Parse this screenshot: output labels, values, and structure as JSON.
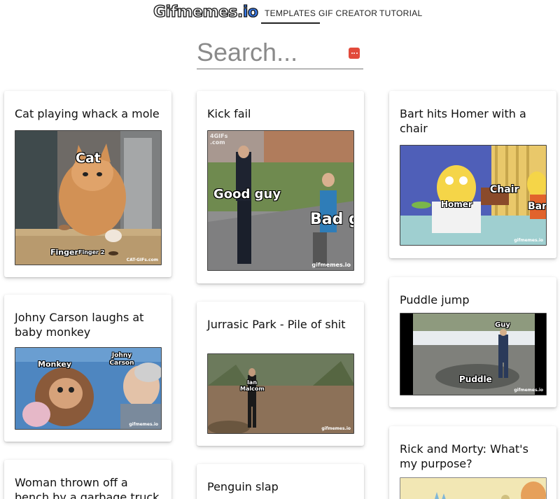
{
  "header": {
    "logo_main": "Gifmemes.",
    "logo_accent": "io",
    "nav": {
      "templates": "TEMPLATES",
      "gif_creator": "GIF CREATOR",
      "tutorial": "TUTORIAL"
    },
    "active_tab": "TEMPLATES"
  },
  "search": {
    "placeholder": "Search...",
    "value": ""
  },
  "cards": {
    "cat": {
      "title": "Cat playing whack a mole",
      "cap_cat": "Cat",
      "cap_finger": "Finger",
      "cap_finger2": "Finger 2",
      "watermark": "CAT-GIFs.com"
    },
    "kick": {
      "title": "Kick fail",
      "cap_good": "Good guy",
      "cap_bad": "Bad gu",
      "watermark": "gifmemes.io",
      "corner": "4GIFs .com"
    },
    "bart": {
      "title": "Bart hits Homer with a chair",
      "cap_chair": "Chair",
      "cap_homer": "Homer",
      "cap_bart": "Bar",
      "watermark": "gifmemes.io"
    },
    "johny": {
      "title": "Johny Carson laughs at baby monkey",
      "cap_monkey": "Monkey",
      "cap_carson": "Johny Carson",
      "watermark": "gifmemes.io"
    },
    "jurassic": {
      "title": "Jurrasic Park - Pile of shit",
      "cap_ian": "Ian Malcom",
      "watermark": "gifmemes.io"
    },
    "puddle": {
      "title": "Puddle jump",
      "cap_guy": "Guy",
      "cap_puddle": "Puddle",
      "watermark": "gifmemes.io"
    },
    "woman": {
      "title": "Woman thrown off a bench by a garbage truck"
    },
    "penguin": {
      "title": "Penguin slap"
    },
    "rick": {
      "title": "Rick and Morty: What's my purpose?"
    }
  },
  "colors": {
    "logo_accent": "#3a7be8",
    "search_button": "#e24a3b",
    "card_bg": "#ffffff"
  }
}
